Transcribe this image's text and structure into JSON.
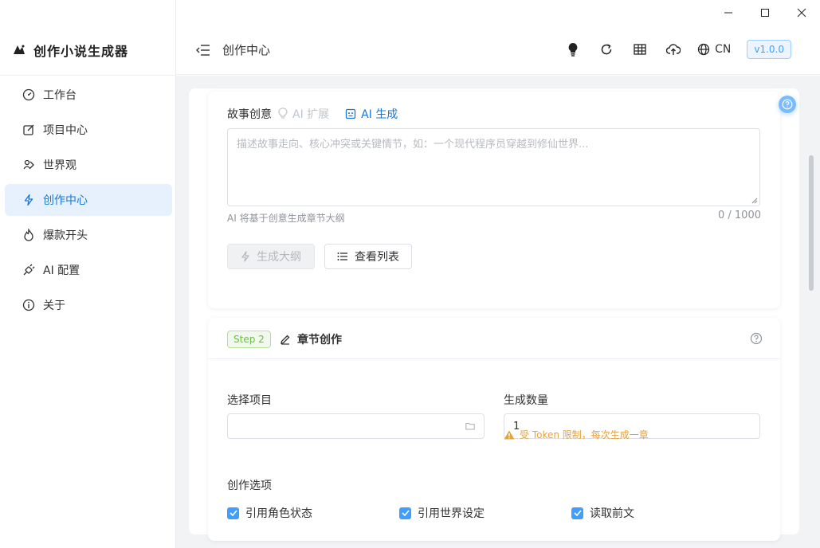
{
  "app": {
    "brand_name": "创作小说生成器",
    "version": "v1.0.0",
    "language": "CN"
  },
  "sidebar": {
    "items": [
      {
        "label": "工作台",
        "icon": "dashboard-icon"
      },
      {
        "label": "项目中心",
        "icon": "edit-square-icon"
      },
      {
        "label": "世界观",
        "icon": "world-icon"
      },
      {
        "label": "创作中心",
        "icon": "lightning-icon",
        "active": true
      },
      {
        "label": "爆款开头",
        "icon": "fire-icon"
      },
      {
        "label": "AI 配置",
        "icon": "plug-icon"
      },
      {
        "label": "关于",
        "icon": "info-icon"
      }
    ]
  },
  "header": {
    "title": "创作中心"
  },
  "story": {
    "label": "故事创意",
    "ai_expand": "AI 扩展",
    "ai_generate": "AI 生成",
    "placeholder": "描述故事走向、核心冲突或关键情节，如：一个现代程序员穿越到修仙世界...",
    "hint": "AI 将基于创意生成章节大纲",
    "counter": "0 / 1000",
    "btn_generate": "生成大纲",
    "btn_view_list": "查看列表"
  },
  "step2": {
    "tag": "Step 2",
    "title": "章节创作",
    "project_label": "选择项目",
    "project_value": "",
    "count_label": "生成数量",
    "count_value": "1",
    "warning": "受 Token 限制，每次生成一章",
    "options_label": "创作选项",
    "options": [
      {
        "label": "引用角色状态",
        "checked": true
      },
      {
        "label": "引用世界设定",
        "checked": true
      },
      {
        "label": "读取前文",
        "checked": true
      }
    ]
  },
  "colors": {
    "primary": "#409eff",
    "active_bg": "#e6f1fd",
    "success": "#67c23a",
    "warning": "#e6a23c"
  }
}
